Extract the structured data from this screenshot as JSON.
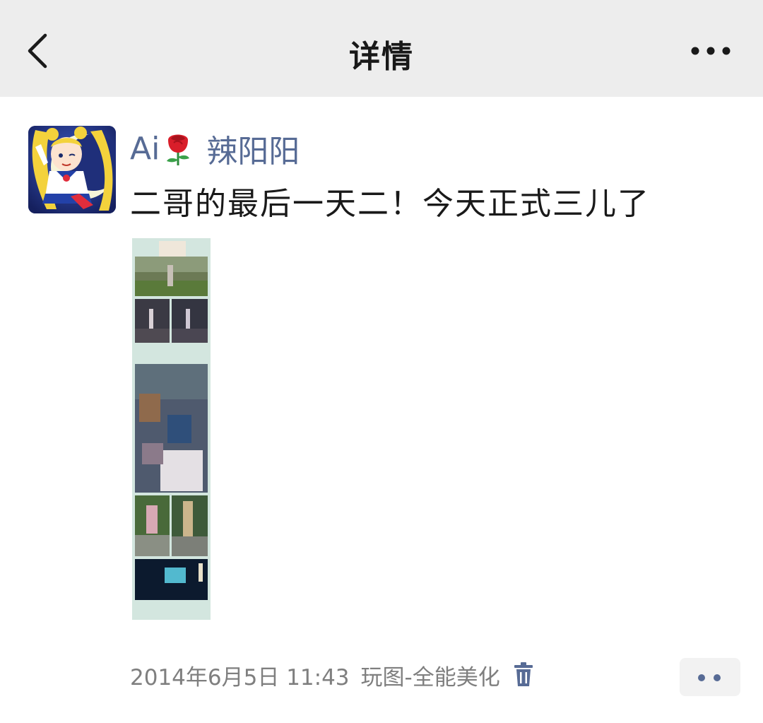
{
  "nav": {
    "title": "详情",
    "back_icon": "chevron-left-icon",
    "more_icon": "more-horizontal-icon"
  },
  "post": {
    "author_prefix": "Ai",
    "author_emoji": "rose",
    "author_name": "辣阳阳",
    "text": "二哥的最后一天二！今天正式三儿了",
    "timestamp": "2014年6月5日 11:43",
    "source_app": "玩图-全能美化",
    "delete_icon": "trash-icon",
    "comment_icon": "more-dots-icon"
  },
  "colors": {
    "nav_bg": "#ededed",
    "link": "#576b95",
    "text": "#191919",
    "meta": "#7f7f7f"
  }
}
